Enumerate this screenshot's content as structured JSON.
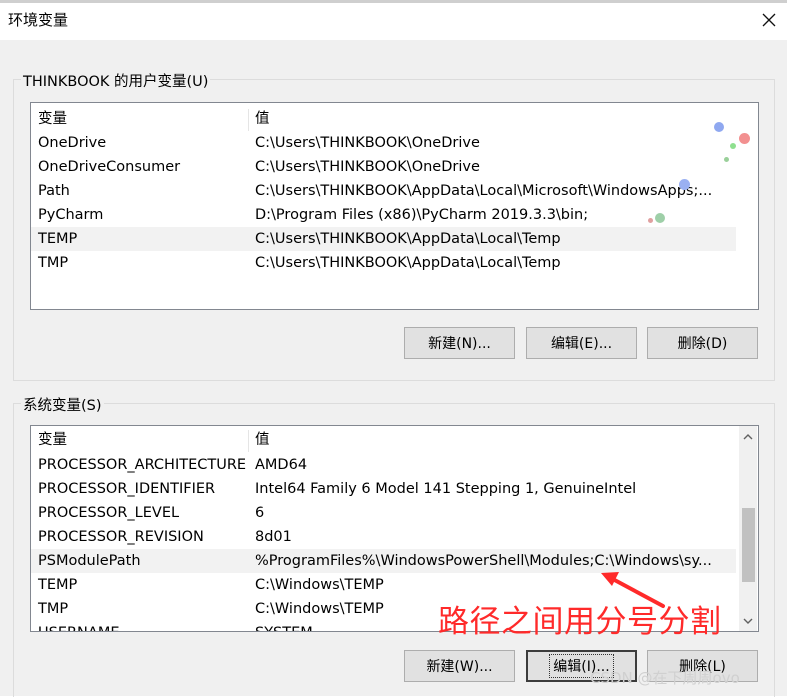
{
  "window": {
    "title": "环境变量"
  },
  "user_group": {
    "title": "THINKBOOK 的用户变量(U)",
    "header": {
      "name": "变量",
      "value": "值"
    },
    "rows": [
      {
        "name": "OneDrive",
        "value": "C:\\Users\\THINKBOOK\\OneDrive"
      },
      {
        "name": "OneDriveConsumer",
        "value": "C:\\Users\\THINKBOOK\\OneDrive"
      },
      {
        "name": "Path",
        "value": "C:\\Users\\THINKBOOK\\AppData\\Local\\Microsoft\\WindowsApps;..."
      },
      {
        "name": "PyCharm",
        "value": "D:\\Program Files (x86)\\PyCharm 2019.3.3\\bin;"
      },
      {
        "name": "TEMP",
        "value": "C:\\Users\\THINKBOOK\\AppData\\Local\\Temp"
      },
      {
        "name": "TMP",
        "value": "C:\\Users\\THINKBOOK\\AppData\\Local\\Temp"
      }
    ],
    "buttons": {
      "new": "新建(N)...",
      "edit": "编辑(E)...",
      "delete": "删除(D)"
    }
  },
  "system_group": {
    "title": "系统变量(S)",
    "header": {
      "name": "变量",
      "value": "值"
    },
    "rows": [
      {
        "name": "PROCESSOR_ARCHITECTURE",
        "value": "AMD64"
      },
      {
        "name": "PROCESSOR_IDENTIFIER",
        "value": "Intel64 Family 6 Model 141 Stepping 1, GenuineIntel"
      },
      {
        "name": "PROCESSOR_LEVEL",
        "value": "6"
      },
      {
        "name": "PROCESSOR_REVISION",
        "value": "8d01"
      },
      {
        "name": "PSModulePath",
        "value": "%ProgramFiles%\\WindowsPowerShell\\Modules;C:\\Windows\\sy..."
      },
      {
        "name": "TEMP",
        "value": "C:\\Windows\\TEMP"
      },
      {
        "name": "TMP",
        "value": "C:\\Windows\\TEMP"
      },
      {
        "name": "USERNAME",
        "value": "SYSTEM"
      }
    ],
    "buttons": {
      "new": "新建(W)...",
      "edit": "编辑(I)...",
      "delete": "删除(L)"
    }
  },
  "annotation": {
    "text": "路径之间用分号分割",
    "color": "#ff2a2a"
  },
  "watermark": {
    "text": "CSDN @在下周周ovo"
  },
  "icons": {
    "close": "close-icon",
    "scroll_up": "scroll-up-arrow-icon",
    "scroll_down": "scroll-down-arrow-icon"
  }
}
